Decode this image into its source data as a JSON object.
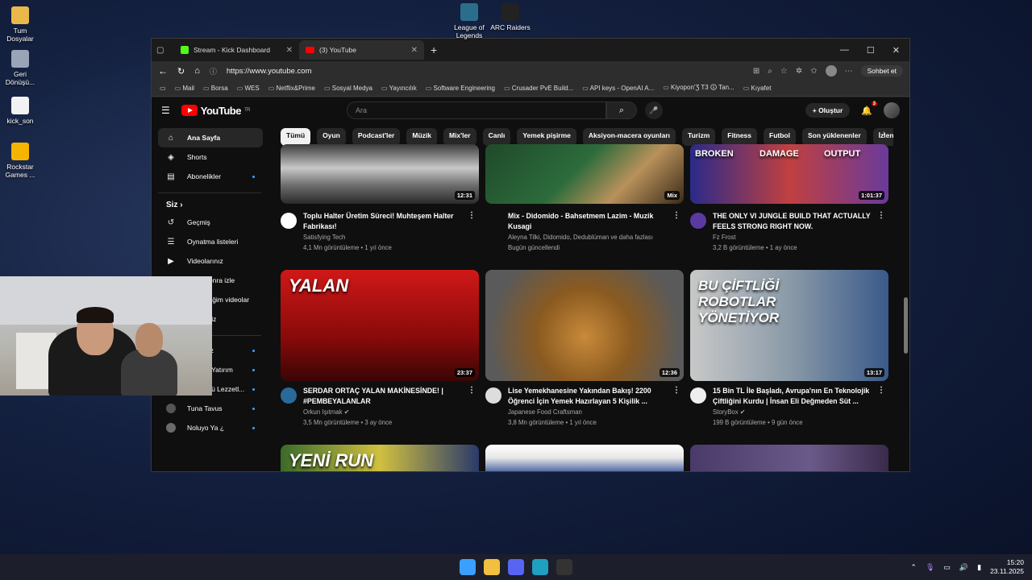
{
  "desktop": {
    "icons_left": [
      {
        "label": "Tum Dosyalar",
        "color": "#e8b84a"
      },
      {
        "label": "Geri Dönüşü...",
        "color": "#9aa4b8"
      },
      {
        "label": "kick_son",
        "color": "#f2f2f2"
      },
      {
        "label": "Rockstar Games ...",
        "color": "#f5b400"
      }
    ],
    "icons_top": [
      {
        "label": "League of Legends",
        "color": "#2a6e8c"
      },
      {
        "label": "ARC Raiders",
        "color": "#222222"
      }
    ]
  },
  "browser": {
    "tabs": [
      {
        "label": "Stream - Kick Dashboard",
        "icon": "kick-icon",
        "active": false
      },
      {
        "label": "(3) YouTube",
        "icon": "youtube-icon",
        "active": true
      }
    ],
    "window_controls": [
      "—",
      "☐",
      "✕"
    ],
    "url": "https://www.youtube.com",
    "copilot_label": "Sohbet et",
    "bookmarks": [
      "Mail",
      "Borsa",
      "WES",
      "Netflix&Prime",
      "Sosyal Medya",
      "Yayıncılık",
      "Software Engineering",
      "Crusader PvE Build...",
      "API keys - OpenAI A...",
      "Kiyopon'Ʒ T3 🛈 Tan...",
      "Kıyafet"
    ]
  },
  "youtube": {
    "logo_text": "YouTube",
    "logo_region": "TR",
    "search_placeholder": "Ara",
    "create_label": "Oluştur",
    "notification_count": "3",
    "sidebar": {
      "main": [
        {
          "label": "Ana Sayfa",
          "icon": "home-icon",
          "glyph": "⌂",
          "active": true
        },
        {
          "label": "Shorts",
          "icon": "shorts-icon",
          "glyph": "◈"
        },
        {
          "label": "Abonelikler",
          "icon": "subscriptions-icon",
          "glyph": "▤",
          "dot": true
        }
      ],
      "you_title": "Siz",
      "you": [
        {
          "label": "Geçmiş",
          "icon": "history-icon",
          "glyph": "↺"
        },
        {
          "label": "Oynatma listeleri",
          "icon": "playlists-icon",
          "glyph": "☰"
        },
        {
          "label": "Videolarınız",
          "icon": "your-videos-icon",
          "glyph": "▶"
        },
        {
          "label": "Daha sonra izle",
          "icon": "watch-later-icon",
          "glyph": "◷"
        },
        {
          "label": "Beğendiğim videolar",
          "icon": "liked-icon",
          "glyph": "👍"
        },
        {
          "label": "Klipleriniz",
          "icon": "clips-icon",
          "glyph": "✂"
        }
      ],
      "subs": [
        {
          "label": "Artizrezz",
          "color": "#b54a3a"
        },
        {
          "label": "Merkez Yatırım",
          "color": "#3a5a9a"
        },
        {
          "label": "Ayaküstü Lezzetl...",
          "color": "#cc2222"
        },
        {
          "label": "Tuna Tavus",
          "color": "#555555"
        },
        {
          "label": "Noluyo Ya ¿",
          "color": "#6a6a6a"
        }
      ]
    },
    "chips": [
      "Tümü",
      "Oyun",
      "Podcast'ler",
      "Müzik",
      "Mix'ler",
      "Canlı",
      "Yemek pişirme",
      "Aksiyon-macera oyunları",
      "Turizm",
      "Fitness",
      "Futbol",
      "Son yüklenenler",
      "İzlenenler"
    ],
    "videos_row1": [
      {
        "title": "Toplu Halter Üretim Süreci! Muhteşem Halter Fabrikası!",
        "channel": "Satisfying Tech",
        "stats": "4,1 Mn görüntüleme • 1 yıl önce",
        "duration": "12:31",
        "thumb": "linear-gradient(180deg,#3b3b3b,#c8c8c8 40%,#6b6b6b 70%,#2a2a2a)",
        "ch_color": "#ffffff"
      },
      {
        "title": "Mix - Didomido - Bahsetmem Lazim - Muzik Kusagi",
        "channel": "Aleyna Tilki, Didomido, Dedublüman ve daha fazlası",
        "stats": "Bugün güncellendi",
        "duration": "Mix",
        "thumb": "linear-gradient(135deg,#1f4a2a,#2c6b3b 45%,#b8915a 70%,#3a2a1a)",
        "ch_color": ""
      },
      {
        "title": "THE ONLY VI JUNGLE BUILD THAT ACTUALLY FEELS STRONG RIGHT NOW.",
        "channel": "Fz Frost",
        "stats": "3,2 B görüntüleme • 1 ay önce",
        "duration": "1:01:37",
        "thumb": "linear-gradient(90deg,#2a2a8a,#c04040 50%,#6a3a9a)",
        "ch_color": "#5a3aa0",
        "overlay": [
          "BROKEN",
          "DAMAGE",
          "OUTPUT"
        ]
      }
    ],
    "videos_row2": [
      {
        "title": "SERDAR ORTAÇ YALAN MAKİNESİNDE! | #PEMBEYALANLAR",
        "channel": "Orkun Işıtmak",
        "stats": "3,5 Mn görüntüleme • 3 ay önce",
        "duration": "23:37",
        "thumb": "linear-gradient(180deg,#d01818,#8a0a0a 60%,#3a0505)",
        "ch_color": "#2a6a9a",
        "overlay": "YALAN",
        "verified": true
      },
      {
        "title": "Lise Yemekhanesine Yakından Bakış! 2200 Öğrenci İçin Yemek Hazırlayan 5 Kişilik ...",
        "channel": "Japanese Food Craftsman",
        "stats": "3,8 Mn görüntüleme • 1 yıl önce",
        "duration": "12:36",
        "thumb": "radial-gradient(circle at 50% 60%,#c98a3a,#8a5a20 40%,#5a5a5a 80%)",
        "ch_color": "#dddddd"
      },
      {
        "title": "15 Bin TL İle Başladı, Avrupa'nın En Teknolojik Çiftliğini Kurdu | İnsan Eli Değmeden Süt ...",
        "channel": "StoryBox",
        "stats": "199 B görüntüleme • 9 gün önce",
        "duration": "13:17",
        "thumb": "linear-gradient(90deg,#c8c8c8,#8a9aa8 50%,#3a5a8a)",
        "ch_color": "#eeeeee",
        "overlay": "BU ÇİFTLİĞİ ROBOTLAR YÖNETİYOR",
        "verified": true
      }
    ],
    "row3_thumbs": [
      {
        "thumb": "linear-gradient(90deg,#3a6a2a,#d0c040 50%,#2a3a6a)",
        "overlay": "YENİ RUN"
      },
      {
        "thumb": "linear-gradient(180deg,#ffffff,#e8e8e8 40%,#1a3a8a)",
        "overlay": ""
      },
      {
        "thumb": "linear-gradient(90deg,#4a3a6a,#6a5a8a 60%,#3a2a4a)",
        "overlay": ""
      }
    ]
  },
  "taskbar": {
    "icons": [
      {
        "name": "windows-start-icon",
        "color": "#3aa0ff"
      },
      {
        "name": "file-explorer-icon",
        "color": "#f2c040"
      },
      {
        "name": "discord-icon",
        "color": "#5865f2"
      },
      {
        "name": "edge-icon",
        "color": "#1fa0c0"
      },
      {
        "name": "obs-icon",
        "color": "#333333"
      }
    ],
    "time": "15:20",
    "date": "23.11.2025"
  }
}
